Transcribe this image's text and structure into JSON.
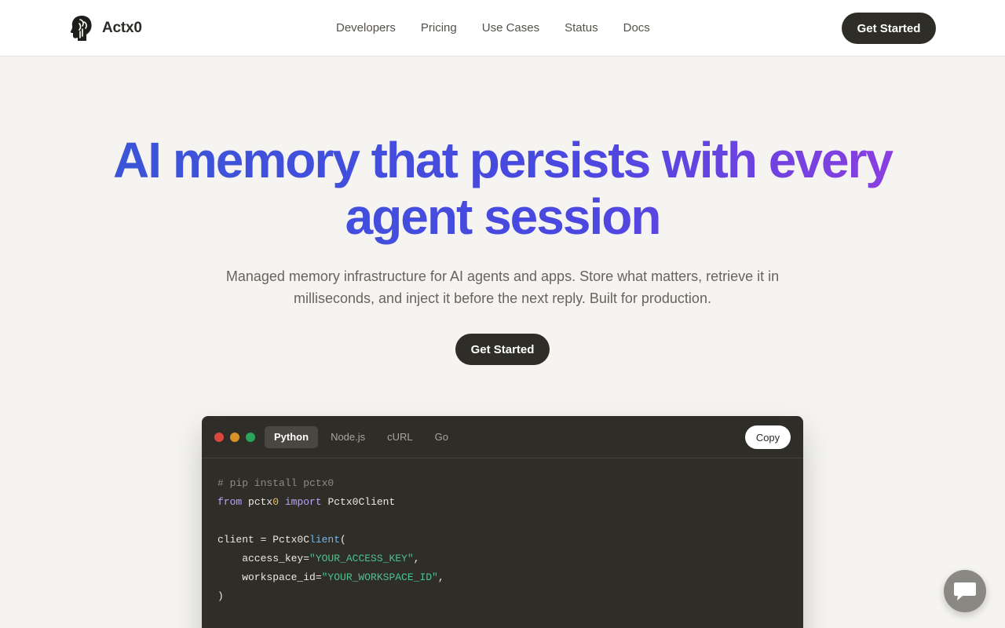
{
  "brand": {
    "name": "Actx0"
  },
  "nav": {
    "links": [
      "Developers",
      "Pricing",
      "Use Cases",
      "Status",
      "Docs"
    ],
    "cta": "Get Started"
  },
  "hero": {
    "title_line1": "AI memory that persists with every",
    "title_line2": "agent session",
    "subtitle_line1": "Managed memory infrastructure for AI agents and apps. Store what matters, retrieve it in",
    "subtitle_line2": "milliseconds, and inject it before the next reply. Built for production.",
    "cta": "Get Started"
  },
  "code_window": {
    "tabs": [
      "Python",
      "Node.js",
      "cURL",
      "Go"
    ],
    "active_tab": "Python",
    "copy_label": "Copy",
    "lines": {
      "l1": "# pip install pctx0",
      "l2_from": "from",
      "l2_mod_a": " pctx",
      "l2_mod_b": "0",
      "l2_import": " import",
      "l2_cls": " Pctx0Client",
      "l4_a": "client = Pctx0C",
      "l4_b": "lient",
      "l4_c": "(",
      "l5_key": "    access_key=",
      "l5_val": "\"YOUR_ACCESS_KEY\"",
      "l5_end": ",",
      "l6_key": "    workspace_id=",
      "l6_val": "\"YOUR_WORKSPACE_ID\"",
      "l6_end": ",",
      "l7": ")"
    }
  },
  "colors": {
    "accent_dark": "#2f2d28",
    "title_gradient_start": "#3b55d8",
    "title_gradient_end": "#8a3fe0",
    "background": "#f5f4f1"
  },
  "icons": {
    "brand": "head-logo-icon",
    "chat": "chat-bubble-icon"
  }
}
